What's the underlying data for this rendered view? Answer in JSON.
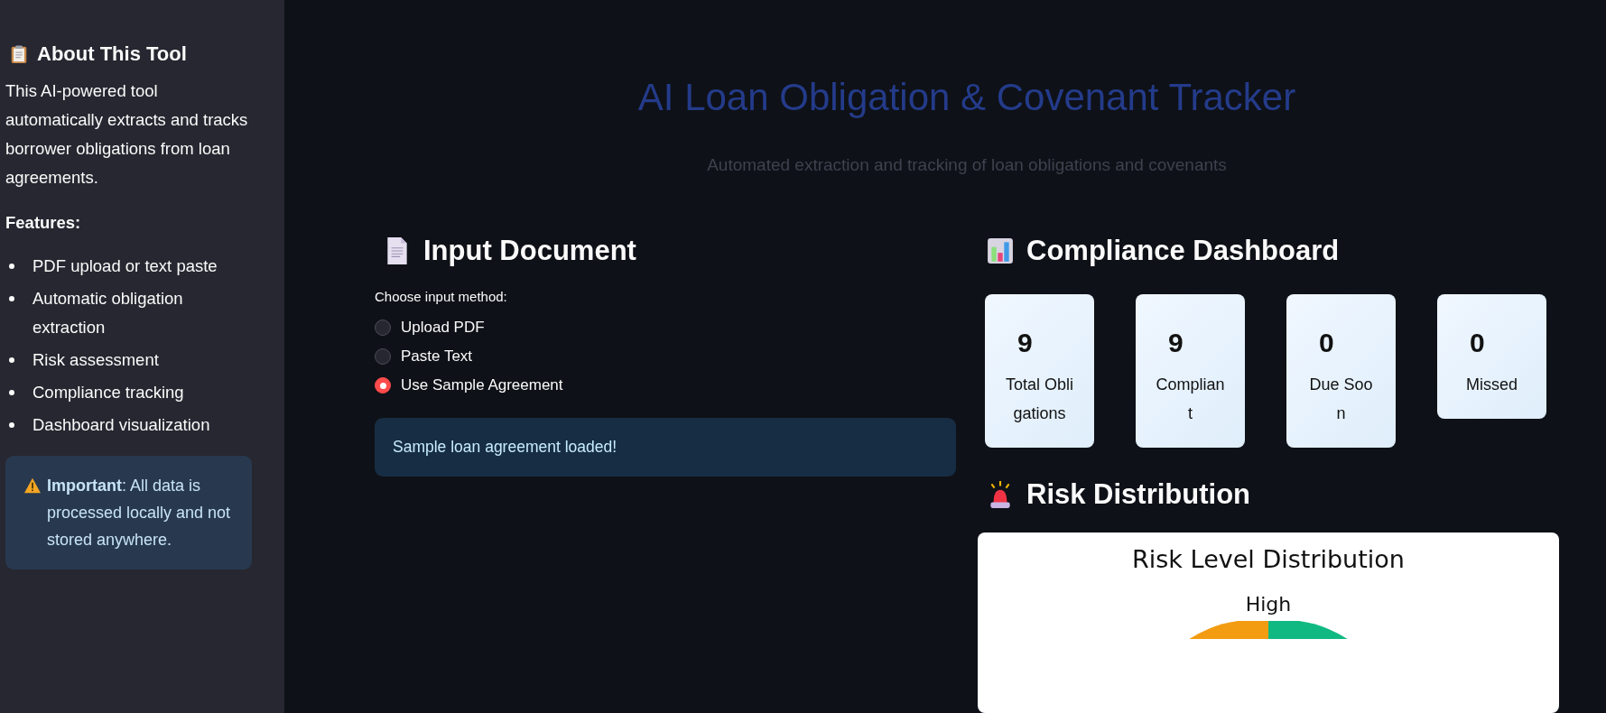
{
  "sidebar": {
    "title": "About This Tool",
    "intro": "This AI-powered tool automatically extracts and tracks borrower obligations from loan agreements.",
    "features_heading": "Features:",
    "features": [
      "PDF upload or text paste",
      "Automatic obligation extraction",
      "Risk assessment",
      "Compliance tracking",
      "Dashboard visualization"
    ],
    "notice": "**Important**: All data is processed locally and not stored anywhere."
  },
  "header": {
    "title": "AI Loan Obligation & Covenant Tracker",
    "subtitle": "Automated extraction and tracking of loan obligations and covenants"
  },
  "input": {
    "heading": "Input Document",
    "method_label": "Choose input method:",
    "options": [
      {
        "label": "Upload PDF",
        "selected": false
      },
      {
        "label": "Paste Text",
        "selected": false
      },
      {
        "label": "Use Sample Agreement",
        "selected": true
      }
    ],
    "status": "Sample loan agreement loaded!"
  },
  "dashboard": {
    "heading": "Compliance Dashboard",
    "metrics": [
      {
        "value": "9",
        "label": "Total Obligations"
      },
      {
        "value": "9",
        "label": "Compliant"
      },
      {
        "value": "0",
        "label": "Due Soon"
      },
      {
        "value": "0",
        "label": "Missed"
      }
    ]
  },
  "risk": {
    "heading": "Risk Distribution",
    "chart_title": "Risk Level Distribution",
    "slice_label": "High"
  }
}
